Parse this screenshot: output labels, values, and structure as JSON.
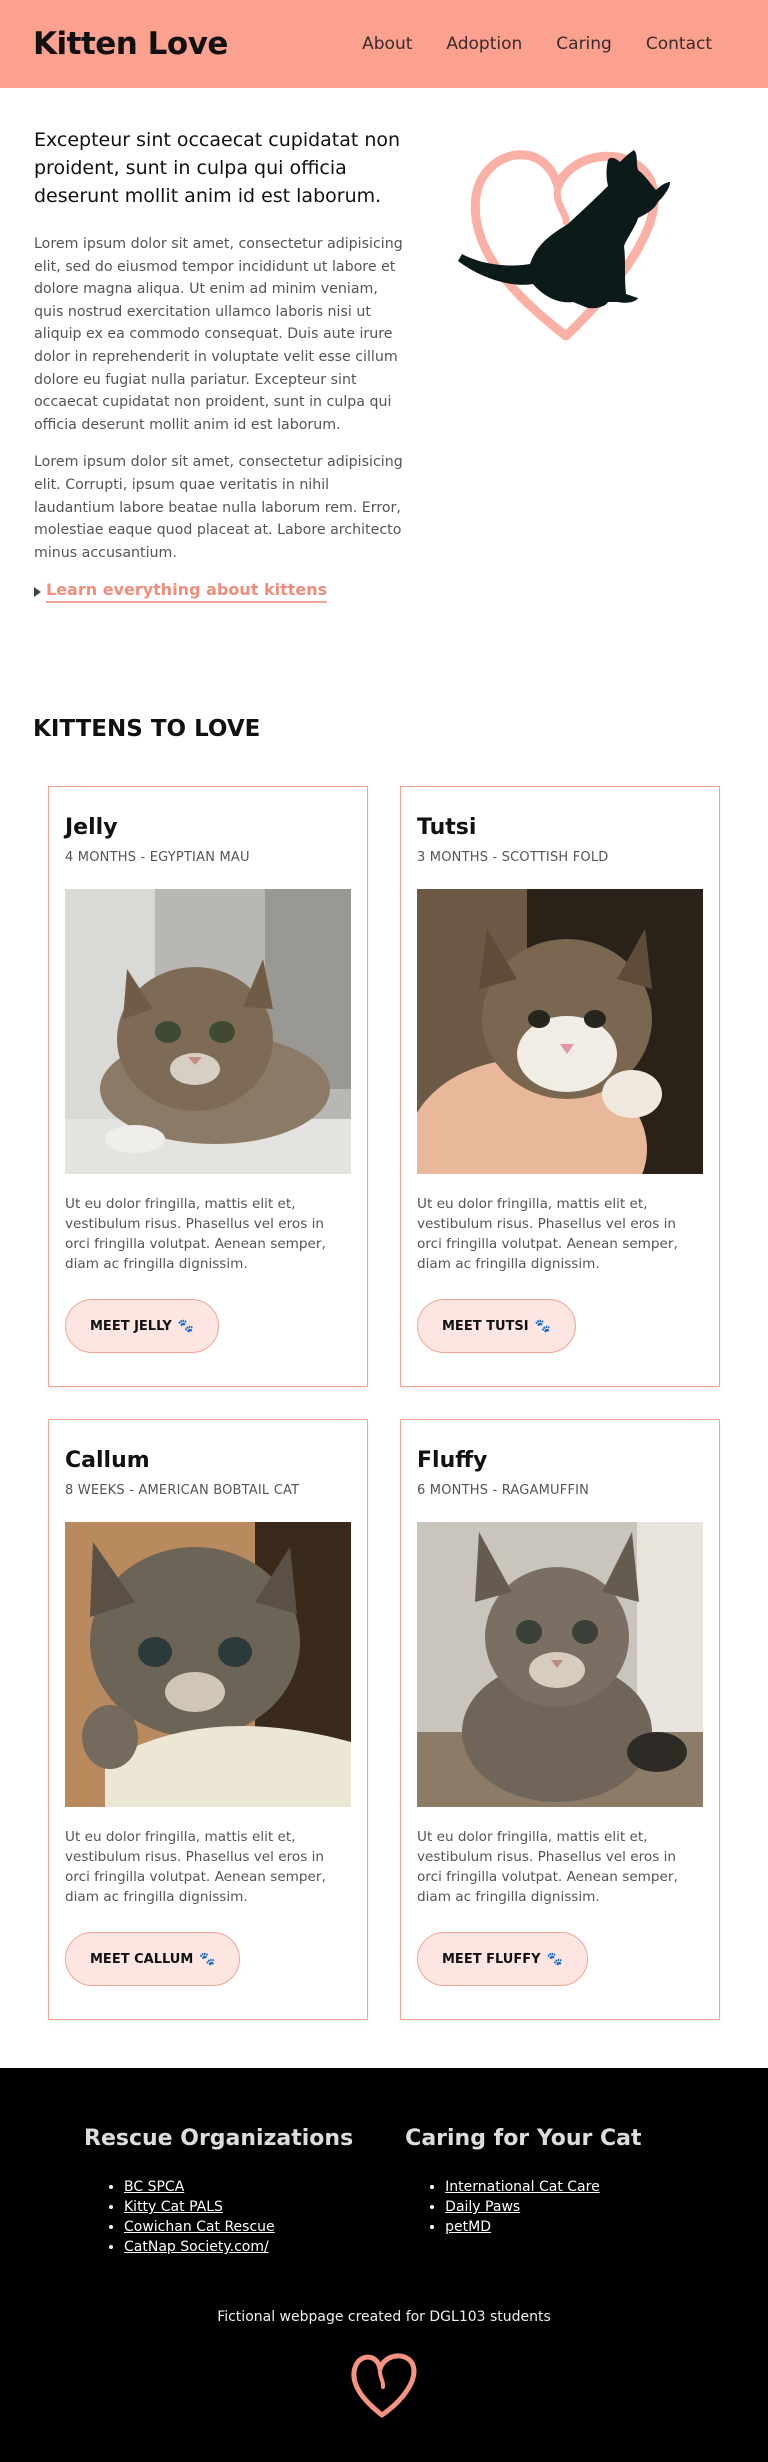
{
  "header": {
    "logo": "Kitten Love",
    "nav": [
      "About",
      "Adoption",
      "Caring",
      "Contact"
    ]
  },
  "intro": {
    "heading": "Excepteur sint occaecat cupidatat non proident, sunt in culpa qui officia deserunt mollit anim id est laborum.",
    "para1": "Lorem ipsum dolor sit amet, consectetur adipisicing elit, sed do eiusmod tempor incididunt ut labore et dolore magna aliqua. Ut enim ad minim veniam, quis nostrud exercitation ullamco laboris nisi ut aliquip ex ea commodo consequat. Duis aute irure dolor in reprehenderit in voluptate velit esse cillum dolore eu fugiat nulla pariatur. Excepteur sint occaecat cupidatat non proident, sunt in culpa qui officia deserunt mollit anim id est laborum.",
    "para2": "Lorem ipsum dolor sit amet, consectetur adipisicing elit. Corrupti, ipsum quae veritatis in nihil laudantium labore beatae nulla laborum rem. Error, molestiae eaque quod placeat at. Labore architecto minus accusantium.",
    "link": "Learn everything about kittens"
  },
  "kittens_section": {
    "title": "KITTENS TO LOVE",
    "cards": [
      {
        "name": "Jelly",
        "meta": "4 MONTHS - EGYPTIAN MAU",
        "desc": "Ut eu dolor fringilla, mattis elit et, vestibulum risus. Phasellus vel eros in orci fringilla volutpat. Aenean semper, diam ac fringilla dignissim.",
        "button": "MEET JELLY"
      },
      {
        "name": "Tutsi",
        "meta": "3 MONTHS - SCOTTISH FOLD",
        "desc": "Ut eu dolor fringilla, mattis elit et, vestibulum risus. Phasellus vel eros in orci fringilla volutpat. Aenean semper, diam ac fringilla dignissim.",
        "button": "MEET TUTSI"
      },
      {
        "name": "Callum",
        "meta": "8 WEEKS - AMERICAN BOBTAIL CAT",
        "desc": "Ut eu dolor fringilla, mattis elit et, vestibulum risus. Phasellus vel eros in orci fringilla volutpat. Aenean semper, diam ac fringilla dignissim.",
        "button": "MEET CALLUM"
      },
      {
        "name": "Fluffy",
        "meta": "6 MONTHS - RAGAMUFFIN",
        "desc": "Ut eu dolor fringilla, mattis elit et, vestibulum risus. Phasellus vel eros in orci fringilla volutpat. Aenean semper, diam ac fringilla dignissim.",
        "button": "MEET FLUFFY"
      }
    ]
  },
  "footer": {
    "col1_title": "Rescue Organizations",
    "col1_links": [
      "BC SPCA",
      "Kitty Cat PALS",
      "Cowichan Cat Rescue",
      "CatNap Society.com/"
    ],
    "col2_title": "Caring for Your Cat",
    "col2_links": [
      "International Cat Care",
      "Daily Paws",
      "petMD"
    ],
    "note": "Fictional webpage created for DGL103 students"
  },
  "colors": {
    "accent": "#fca090",
    "card_border": "#f5a293",
    "button_bg": "#fde6e2",
    "footer_bg": "#000000"
  }
}
